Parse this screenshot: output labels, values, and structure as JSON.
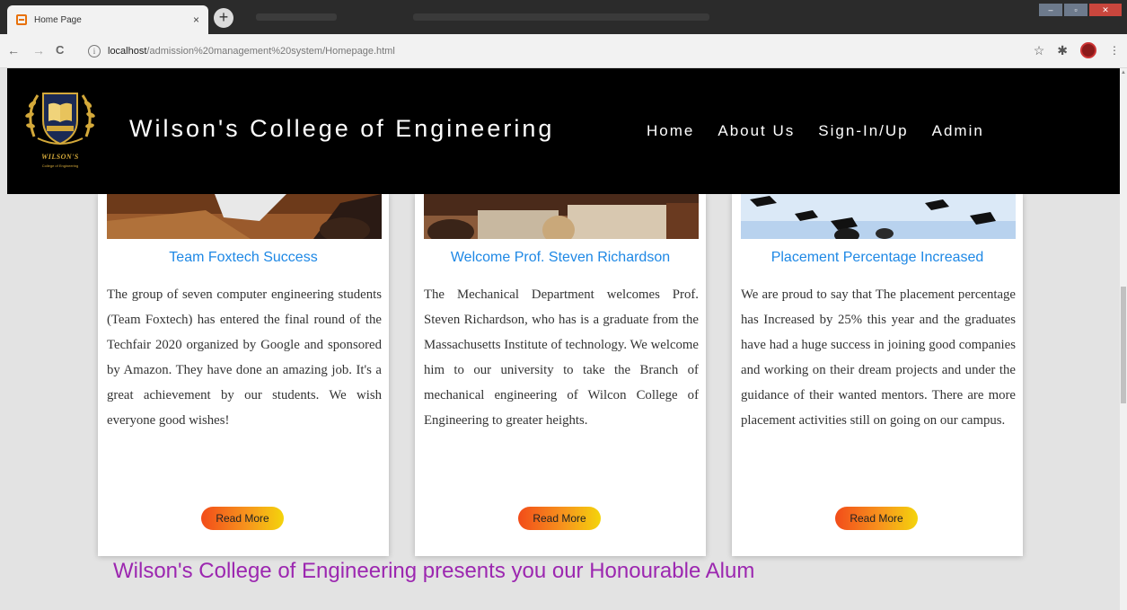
{
  "browser": {
    "tab_title": "Home Page",
    "tab_close": "×",
    "new_tab": "+",
    "url_host": "localhost",
    "url_path": "/admission%20management%20system/Homepage.html",
    "nav_back": "←",
    "nav_forward": "→",
    "nav_reload": "C",
    "star": "☆",
    "extensions": "✱"
  },
  "header": {
    "logo_text": "WILSON'S",
    "logo_subtext": "College of Engineering",
    "title": "Wilson's College of Engineering",
    "nav": [
      {
        "label": "Home"
      },
      {
        "label": "About Us"
      },
      {
        "label": "Sign-In/Up"
      },
      {
        "label": "Admin"
      }
    ]
  },
  "cards": [
    {
      "title": "Team Foxtech Success",
      "text": "The group of seven computer engineering students (Team Foxtech) has entered the final round of the Techfair 2020 organized by Google and sponsored by Amazon. They have done an amazing job. It's a great achievement by our students. We wish everyone good wishes!",
      "button": "Read More"
    },
    {
      "title": "Welcome Prof. Steven Richardson",
      "text": "The Mechanical Department welcomes Prof. Steven Richardson, who has is a graduate from the Massachusetts Institute of technology. We welcome him to our university to take the Branch of mechanical engineering of Wilcon College of Engineering to greater heights.",
      "button": "Read More"
    },
    {
      "title": "Placement Percentage Increased",
      "text": "We are proud to say that The placement percentage has Increased by 25% this year and the graduates have had a huge success in joining good companies and working on their dream projects and under the guidance of their wanted mentors. There are more placement activities still on going on our campus.",
      "button": "Read More"
    }
  ],
  "presents_heading": "Wilson's College of Engineering presents you our Honourable Alum",
  "colors": {
    "header_bg": "#000000",
    "card_title": "#1e88e5",
    "presents": "#9c27b0",
    "button_gradient_start": "#f24c1a",
    "button_gradient_end": "#f4d40c"
  }
}
